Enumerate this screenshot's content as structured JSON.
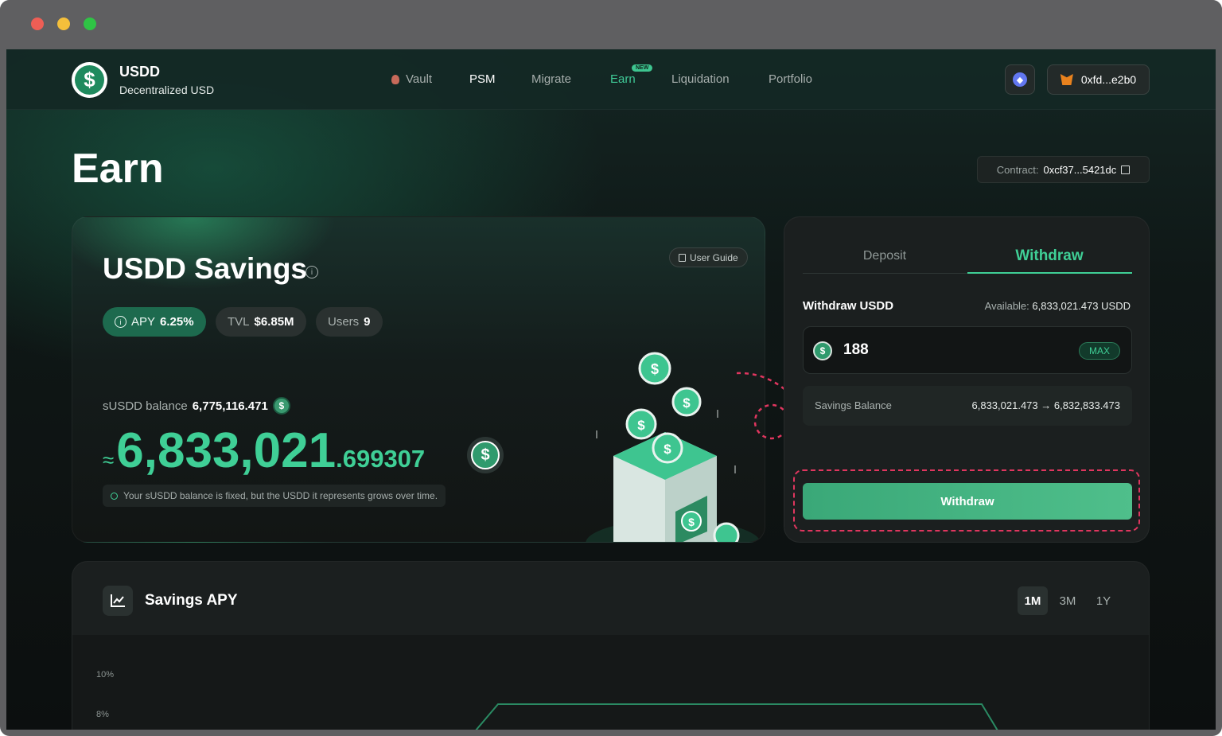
{
  "nav": {
    "brand_title": "USDD",
    "brand_subtitle": "Decentralized USD",
    "links": [
      "Vault",
      "PSM",
      "Migrate",
      "Earn",
      "Liquidation",
      "Portfolio"
    ],
    "new_badge": "NEW",
    "wallet_address": "0xfd...e2b0"
  },
  "page": {
    "title": "Earn",
    "contract_label": "Contract:",
    "contract_address": "0xcf37...5421dc"
  },
  "savings": {
    "title": "USDD Savings",
    "user_guide": "User Guide",
    "apy_label": "APY",
    "apy_value": "6.25%",
    "tvl_label": "TVL",
    "tvl_value": "$6.85M",
    "users_label": "Users",
    "users_value": "9",
    "susdd_label": "sUSDD balance",
    "susdd_value": "6,775,116.471",
    "approx": "≈",
    "balance_int": "6,833,021",
    "balance_dec": ".699307",
    "tip": "Your sUSDD balance is fixed, but the USDD it represents grows over time."
  },
  "panel": {
    "tab_deposit": "Deposit",
    "tab_withdraw": "Withdraw",
    "withdraw_label": "Withdraw USDD",
    "available_label": "Available:",
    "available_value": "6,833,021.473 USDD",
    "amount": "188",
    "max": "MAX",
    "savings_balance_label": "Savings Balance",
    "savings_balance_change": "6,833,021.473 → 6,832,833.473",
    "withdraw_button": "Withdraw"
  },
  "apy_chart": {
    "title": "Savings APY",
    "ranges": [
      "1M",
      "3M",
      "1Y"
    ],
    "active_range": "1M",
    "ticks": [
      "10%",
      "8%"
    ]
  },
  "colors": {
    "accent": "#3fcf96",
    "highlight": "#e0365f"
  }
}
